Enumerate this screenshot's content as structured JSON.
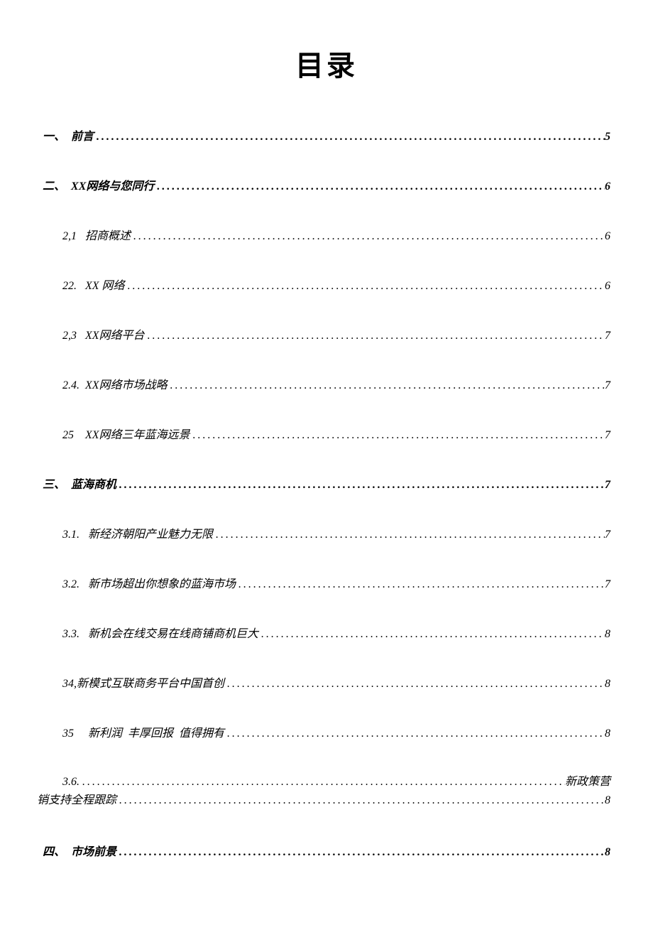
{
  "title": "目录",
  "entries": [
    {
      "level": 1,
      "num": "一、",
      "label": "  前言",
      "page": "5"
    },
    {
      "level": 1,
      "num": "二、",
      "label": "  XX网络与您同行",
      "page": "6"
    },
    {
      "level": 2,
      "num": "2,1",
      "label": "   招商概述",
      "page": "6"
    },
    {
      "level": 2,
      "num": "22.",
      "label": "   XX 网络",
      "page": "6"
    },
    {
      "level": 2,
      "num": "2,3",
      "label": "   XX网络平台",
      "page": "7"
    },
    {
      "level": 2,
      "num": "2.4.",
      "label": "  XX网络市场战略",
      "page": "7"
    },
    {
      "level": 2,
      "num": "25",
      "label": "    XX网络三年蓝海远景",
      "page": "7"
    },
    {
      "level": 1,
      "num": "三、",
      "label": "  蓝海商机",
      "page": "7"
    },
    {
      "level": 2,
      "num": "3.1.",
      "label": "   新经济朝阳产业魅力无限",
      "page": "7"
    },
    {
      "level": 2,
      "num": "3.2.",
      "label": "   新市场超出你想象的蓝海市场",
      "page": "7"
    },
    {
      "level": 2,
      "num": "3.3.",
      "label": "   新机会在线交易在线商铺商机巨大",
      "page": "8"
    },
    {
      "level": 2,
      "num": "34,",
      "label": "新模式互联商务平台中国首创",
      "page": "8"
    },
    {
      "level": 2,
      "num": "35",
      "label": "     新利润  丰厚回报  值得拥有",
      "page": "8"
    }
  ],
  "wrap_entry": {
    "num": "3.6.",
    "tail1": "新政策营",
    "tail2": "销支持全程跟踪",
    "page": "8"
  },
  "last": {
    "level": 1,
    "num": "四、",
    "label": "  市场前景",
    "page": "8"
  },
  "dots": "........................................................................................................................"
}
